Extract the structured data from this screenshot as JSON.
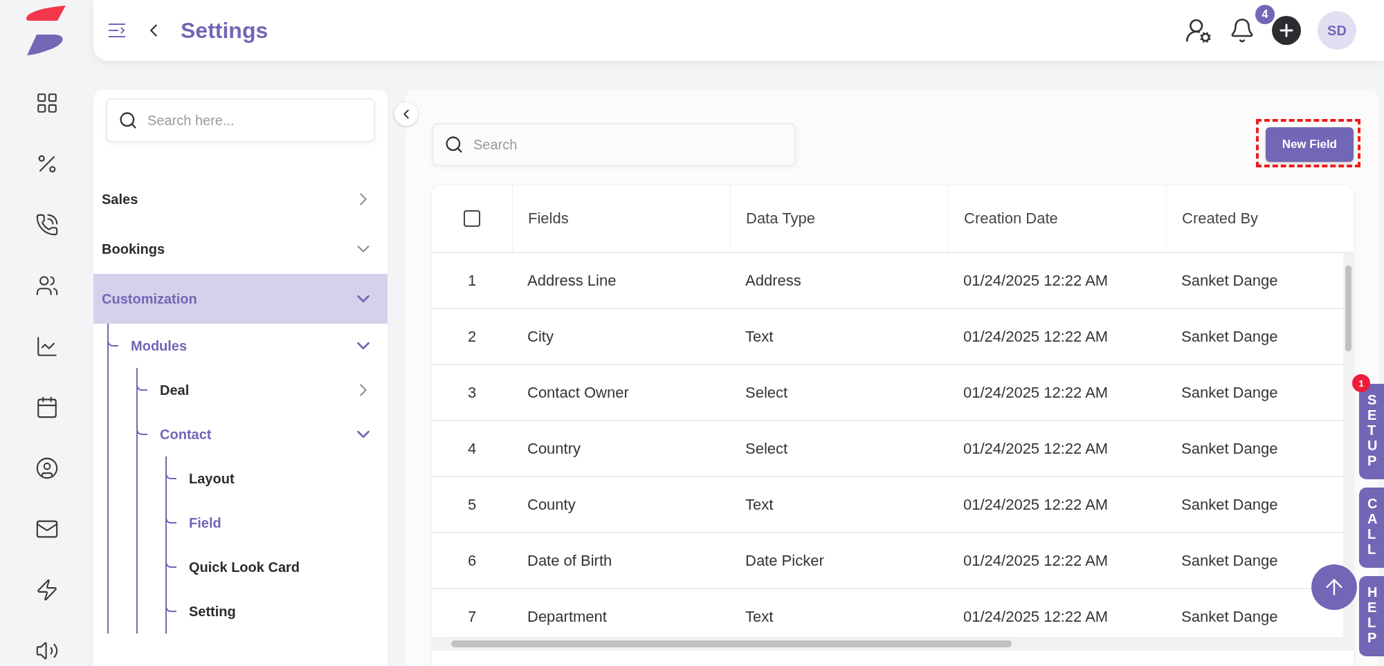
{
  "header": {
    "title": "Settings",
    "notification_count": "4",
    "avatar_initials": "SD"
  },
  "sidebar": {
    "search": {
      "placeholder": "Search here..."
    },
    "items": [
      {
        "label": "Sales",
        "expanded": false,
        "selected": false,
        "active": false
      },
      {
        "label": "Bookings",
        "expanded": true,
        "selected": false,
        "active": false
      },
      {
        "label": "Customization",
        "expanded": true,
        "selected": true,
        "active": true,
        "children": [
          {
            "label": "Modules",
            "expanded": true,
            "active": true,
            "children": [
              {
                "label": "Deal",
                "expanded": false,
                "active": false
              },
              {
                "label": "Contact",
                "expanded": true,
                "active": true,
                "children": [
                  {
                    "label": "Layout",
                    "active": false
                  },
                  {
                    "label": "Field",
                    "active": true
                  },
                  {
                    "label": "Quick Look Card",
                    "active": false
                  },
                  {
                    "label": "Setting",
                    "active": false
                  }
                ]
              }
            ]
          }
        ]
      }
    ]
  },
  "main": {
    "search": {
      "placeholder": "Search"
    },
    "new_field_button": "New Field",
    "table": {
      "header_checkbox": {
        "checked": false
      },
      "columns": [
        "Fields",
        "Data Type",
        "Creation Date",
        "Created By"
      ],
      "rows": [
        {
          "index": "1",
          "field": "Address Line",
          "data_type": "Address",
          "creation_date": "01/24/2025 12:22 AM",
          "created_by": "Sanket Dange"
        },
        {
          "index": "2",
          "field": "City",
          "data_type": "Text",
          "creation_date": "01/24/2025 12:22 AM",
          "created_by": "Sanket Dange"
        },
        {
          "index": "3",
          "field": "Contact Owner",
          "data_type": "Select",
          "creation_date": "01/24/2025 12:22 AM",
          "created_by": "Sanket Dange"
        },
        {
          "index": "4",
          "field": "Country",
          "data_type": "Select",
          "creation_date": "01/24/2025 12:22 AM",
          "created_by": "Sanket Dange"
        },
        {
          "index": "5",
          "field": "County",
          "data_type": "Text",
          "creation_date": "01/24/2025 12:22 AM",
          "created_by": "Sanket Dange"
        },
        {
          "index": "6",
          "field": "Date of Birth",
          "data_type": "Date Picker",
          "creation_date": "01/24/2025 12:22 AM",
          "created_by": "Sanket Dange"
        },
        {
          "index": "7",
          "field": "Department",
          "data_type": "Text",
          "creation_date": "01/24/2025 12:22 AM",
          "created_by": "Sanket Dange"
        }
      ]
    }
  },
  "side_tabs": [
    {
      "label": "SETUP",
      "badge": "1"
    },
    {
      "label": "CALL"
    },
    {
      "label": "HELP"
    }
  ]
}
